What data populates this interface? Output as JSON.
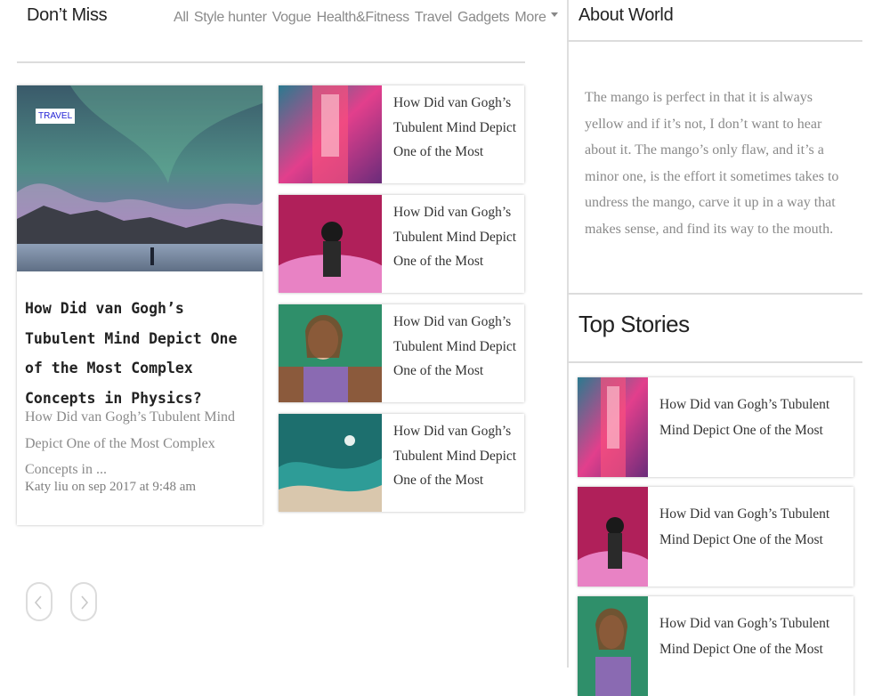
{
  "dont_miss": {
    "title": "Don’t Miss",
    "filters": [
      "All",
      "Style hunter",
      "Vogue",
      "Health&Fitness",
      "Travel",
      "Gadgets",
      "More"
    ]
  },
  "featured": {
    "tag": "TRAVEL",
    "title": "How Did van Gogh’s Tubulent Mind Depict One of the Most Complex Concepts in Physics?",
    "excerpt": "How Did van Gogh’s Tubulent Mind Depict One of the Most Complex Concepts in ...",
    "meta": "Katy liu on sep 2017 at 9:48 am"
  },
  "cards": [
    {
      "title": "How Did van Gogh’s Tubulent Mind Depict One of the Most"
    },
    {
      "title": "How Did van Gogh’s Tubulent Mind Depict One of the Most"
    },
    {
      "title": "How Did van Gogh’s Tubulent Mind Depict One of the Most"
    },
    {
      "title": "How Did van Gogh’s Tubulent Mind Depict One of the Most"
    }
  ],
  "about": {
    "title": "About World",
    "text": "The mango is perfect in that it is always yellow and if it’s not, I don’t want to hear about it. The mango’s only flaw, and it’s a minor one, is the effort it sometimes takes to undress the mango, carve it up in a way that makes sense, and find its way to the mouth."
  },
  "top_stories": {
    "title": "Top Stories",
    "items": [
      {
        "title": "How Did van Gogh’s Tubulent Mind Depict One of the Most"
      },
      {
        "title": "How Did van Gogh’s Tubulent Mind Depict One of the Most"
      },
      {
        "title": "How Did van Gogh’s Tubulent Mind Depict One of the Most"
      }
    ]
  },
  "icons": {
    "prev": "chevron-left-icon",
    "next": "chevron-right-icon",
    "more": "caret-down-icon"
  },
  "colors": {
    "tag_text": "#2323d6",
    "muted_text": "#8a8a8a",
    "divider": "#dcdcdc"
  }
}
